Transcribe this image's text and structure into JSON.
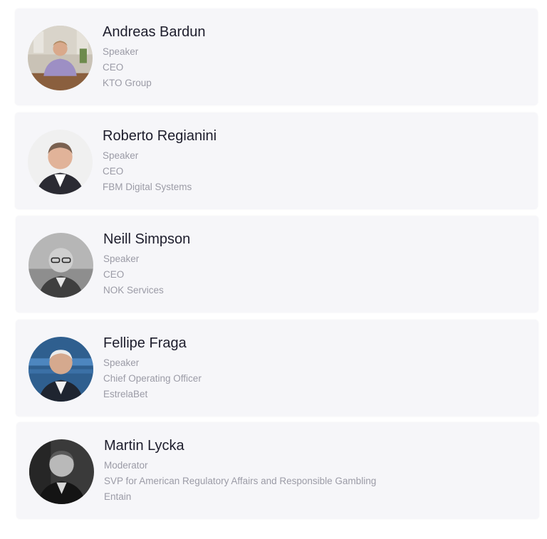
{
  "speakers": [
    {
      "name": "Andreas Bardun",
      "role": "Speaker",
      "title": "CEO",
      "company": "KTO Group"
    },
    {
      "name": "Roberto Regianini",
      "role": "Speaker",
      "title": "CEO",
      "company": "FBM Digital Systems"
    },
    {
      "name": "Neill Simpson",
      "role": "Speaker",
      "title": "CEO",
      "company": "NOK Services"
    },
    {
      "name": "Fellipe Fraga",
      "role": "Speaker",
      "title": "Chief Operating Officer",
      "company": "EstrelaBet"
    },
    {
      "name": "Martin Lycka",
      "role": "Moderator",
      "title": "SVP for American Regulatory Affairs and Responsible Gambling",
      "company": "Entain"
    }
  ]
}
